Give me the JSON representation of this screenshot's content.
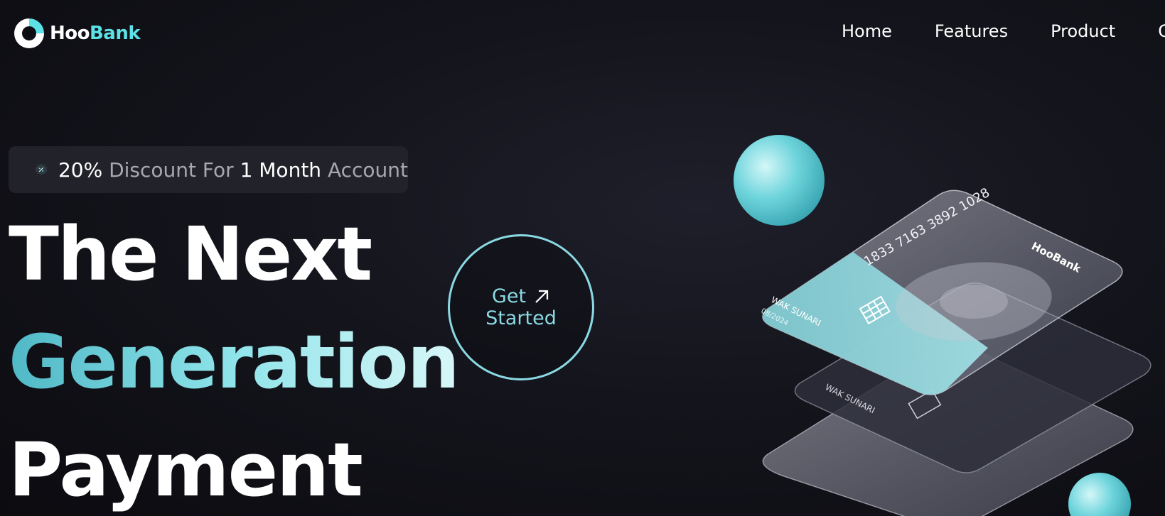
{
  "brand": {
    "name_part1": "Hoo",
    "name_part2": "Bank"
  },
  "nav": {
    "items": [
      {
        "label": "Home"
      },
      {
        "label": "Features"
      },
      {
        "label": "Product"
      },
      {
        "label": "C"
      }
    ]
  },
  "promo": {
    "percent": "20%",
    "text1": " Discount For ",
    "duration": "1 Month",
    "text2": " Account"
  },
  "hero": {
    "line1": "The Next",
    "line2": "Generation",
    "line3": "Payment"
  },
  "cta": {
    "line1": "Get",
    "line2": "Started"
  },
  "card": {
    "number": "1833 7163 3892 1028",
    "holder": "WAK SUNARI",
    "expiry": "08/2024",
    "brand": "HooBank"
  },
  "colors": {
    "accent": "#5ce1e6",
    "cta_border": "#8ad9e3",
    "background": "#0f0f16"
  }
}
